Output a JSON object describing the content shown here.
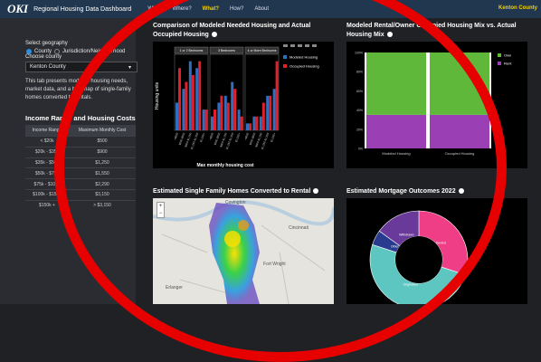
{
  "topbar": {
    "logo": "OKI",
    "title": "Regional Housing Data Dashboard",
    "nav": [
      "Why?",
      "Where?",
      "What?",
      "How?",
      "About"
    ],
    "region": "Kenton County"
  },
  "sidebar": {
    "geo_label": "Select geography",
    "radio_county": "County",
    "radio_jurisdiction": "Jurisdiction/Neighborhood",
    "choose_label": "Choose county",
    "selected_county": "Kenton County",
    "description": "This tab presents modeled housing needs, market data, and a heatmap of single-family homes converted to rentals.",
    "cost_title": "Income Range and Housing Costs",
    "cost_headers": [
      "Income Range",
      "Maximum Monthly Cost"
    ],
    "cost_rows": [
      [
        "< $20k",
        "$500"
      ],
      [
        "$20k - $35k",
        "$900"
      ],
      [
        "$35k - $50k",
        "$1,250"
      ],
      [
        "$50k - $75k",
        "$1,550"
      ],
      [
        "$75k - $100k",
        "$2,290"
      ],
      [
        "$100k - $150k",
        "$3,150"
      ],
      [
        "$150k +",
        "> $3,150"
      ]
    ]
  },
  "panels": {
    "comparison_title": "Comparison of Modeled Needed Housing and Actual Occupied Housing",
    "mix_title": "Modeled Rental/Owner Occupied Housing Mix vs. Actual Housing Mix",
    "conversion_title": "Estimated Single Family Homes Converted to Rental",
    "mortgage_title": "Estimated Mortgage Outcomes 2022"
  },
  "chart_data": [
    {
      "type": "bar",
      "facets": [
        "1 or 2 Bedrooms",
        "3 Bedrooms",
        "4 or More Bedrooms"
      ],
      "categories": [
        "<$500",
        "$500-$900",
        "$900-$1,250",
        "$1,250-$1,550",
        "$1,550+"
      ],
      "xlabel": "Max monthly housing cost",
      "ylabel": "Housing units",
      "series": [
        {
          "name": "Modeled Housing",
          "color": "#2e6fc0",
          "values": [
            [
              4,
              6,
              10,
              9,
              3
            ],
            [
              2,
              4,
              5,
              7,
              3
            ],
            [
              1,
              2,
              2,
              5,
              6
            ]
          ]
        },
        {
          "name": "Occupied Housing",
          "color": "#e0202a",
          "values": [
            [
              9,
              7,
              8,
              10,
              3
            ],
            [
              3,
              5,
              4,
              6,
              2
            ],
            [
              1,
              2,
              4,
              5,
              10
            ]
          ]
        }
      ]
    },
    {
      "type": "bar",
      "categories": [
        "Modeled Housing",
        "Occupied Housing"
      ],
      "yticks": [
        "100%",
        "80%",
        "60%",
        "40%",
        "20%",
        "0%"
      ],
      "ylim": [
        0,
        100
      ],
      "series": [
        {
          "name": "Rent",
          "color": "#9b3fb5",
          "values": [
            35,
            35
          ]
        },
        {
          "name": "Own",
          "color": "#5fb83a",
          "values": [
            65,
            65
          ]
        }
      ]
    },
    {
      "type": "pie",
      "labels": [
        "Denied",
        "Originated",
        "Other",
        "Withdrawn"
      ],
      "values": [
        30,
        50,
        5,
        15
      ],
      "colors": [
        "#ef3e86",
        "#5ec6c0",
        "#283b8f",
        "#6a3a9a"
      ]
    }
  ],
  "map": {
    "zoom_in": "+",
    "zoom_out": "−",
    "place_labels": [
      "Covington",
      "Cincinnati",
      "Fort Wright",
      "Erlanger"
    ]
  }
}
